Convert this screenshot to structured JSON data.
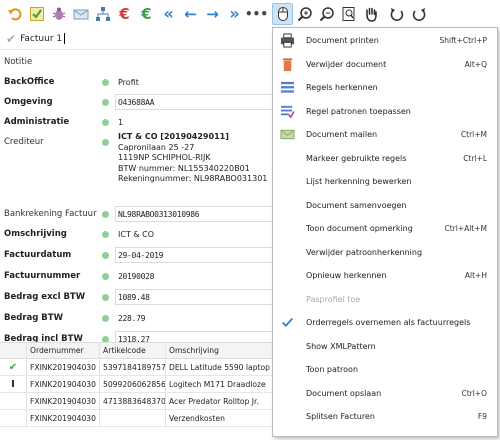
{
  "toolbar": {
    "buttons": [
      "undo",
      "approve",
      "debug",
      "mail",
      "hierarchy",
      "euro-red",
      "euro-green",
      "double-left",
      "left",
      "right",
      "double-right",
      "more",
      "mouse",
      "zoom-in",
      "zoom-out",
      "zoom-fit",
      "hand",
      "rotate-left",
      "rotate-right"
    ]
  },
  "tab": {
    "label": "Factuur 1"
  },
  "form": {
    "notitie": "Notitie",
    "backoffice": {
      "label": "BackOffice",
      "value": "Profit"
    },
    "omgeving": {
      "label": "Omgeving",
      "value": "O43688AA"
    },
    "administratie": {
      "label": "Administratie",
      "value": "1"
    },
    "crediteur": {
      "label": "Crediteur",
      "lines": [
        "ICT & CO [20190429011]",
        "Capronilaan 25 -27",
        "1119NP SCHIPHOL-RIJK",
        "BTW nummer: NL155340220B01",
        "Rekeningnummer: NL98RABO031301"
      ]
    },
    "bankrekening": {
      "label": "Bankrekening Factuur",
      "value": "NL98RABO0313010986"
    },
    "omschrijving": {
      "label": "Omschrijving",
      "value": "ICT & CO"
    },
    "factuurdatum": {
      "label": "Factuurdatum",
      "value": "29-04-2019"
    },
    "factuurnummer": {
      "label": "Factuurnummer",
      "value": "20190028"
    },
    "bedrag_excl": {
      "label": "Bedrag excl BTW",
      "value": "1089.48"
    },
    "bedrag_btw": {
      "label": "Bedrag BTW",
      "value": "228.79"
    },
    "bedrag_incl": {
      "label": "Bedrag incl BTW",
      "value": "1318.27"
    }
  },
  "grid": {
    "headers": [
      "",
      "Ordernummer",
      "Artikelcode",
      "Omschrijving"
    ],
    "rows": [
      {
        "mark": "✔",
        "order": "FXINK201904030",
        "art": "5397184189757",
        "desc": "DELL Latitude 5590 laptop"
      },
      {
        "mark": "I",
        "order": "FXINK201904030",
        "art": "5099206062856",
        "desc": "Logitech M171 Draadloze"
      },
      {
        "mark": "",
        "order": "FXINK201904030",
        "art": "4713883648370",
        "desc": "Acer Predator Rolltop Jr."
      },
      {
        "mark": "",
        "order": "FXINK201904030",
        "art": "",
        "desc": "Verzendkosten"
      }
    ]
  },
  "menu": {
    "items": [
      {
        "icon": "printer-icon",
        "label": "Document printen",
        "shortcut": "Shift+Ctrl+P"
      },
      {
        "icon": "trash-icon",
        "label": "Verwijder document",
        "shortcut": "Alt+Q"
      },
      {
        "icon": "lines-icon",
        "label": "Regels herkennen",
        "shortcut": ""
      },
      {
        "icon": "lines-check-icon",
        "label": "Regel patronen toepassen",
        "shortcut": ""
      },
      {
        "icon": "envelope-icon",
        "label": "Document mailen",
        "shortcut": "Ctrl+M"
      },
      {
        "icon": "",
        "label": "Markeer gebruikte regels",
        "shortcut": "Ctrl+L"
      },
      {
        "icon": "",
        "label": "Lijst herkenning bewerken",
        "shortcut": ""
      },
      {
        "icon": "",
        "label": "Document samenvoegen",
        "shortcut": ""
      },
      {
        "icon": "",
        "label": "Toon document opmerking",
        "shortcut": "Ctrl+Alt+M"
      },
      {
        "icon": "",
        "label": "Verwijder patroonherkenning",
        "shortcut": ""
      },
      {
        "icon": "",
        "label": "Opnieuw herkennen",
        "shortcut": "Alt+H"
      },
      {
        "icon": "",
        "label": "Pasprofiel toe",
        "shortcut": "",
        "disabled": true
      },
      {
        "icon": "checkmark-icon",
        "label": "Orderregels overnemen als factuurregels",
        "shortcut": ""
      },
      {
        "icon": "",
        "label": "Show XMLPattern",
        "shortcut": ""
      },
      {
        "icon": "",
        "label": "Toon patroon",
        "shortcut": ""
      },
      {
        "icon": "",
        "label": "Document opslaan",
        "shortcut": "Ctrl+O"
      },
      {
        "icon": "",
        "label": "Splitsen Facturen",
        "shortcut": "F9"
      }
    ]
  }
}
